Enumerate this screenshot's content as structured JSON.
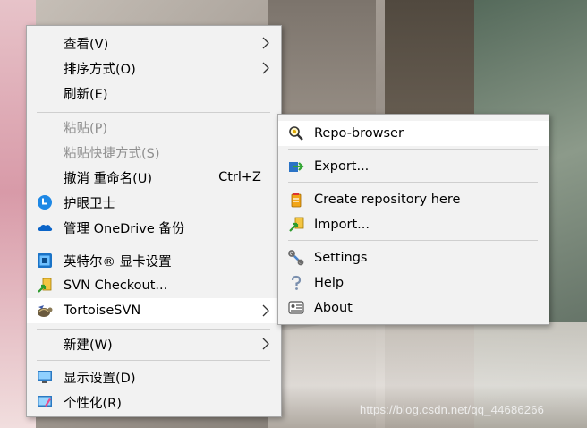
{
  "watermark": "https://blog.csdn.net/qq_44686266",
  "main_menu": {
    "view": "查看(V)",
    "sort": "排序方式(O)",
    "refresh": "刷新(E)",
    "paste": "粘贴(P)",
    "paste_shortcut": "粘贴快捷方式(S)",
    "undo_rename": "撤消 重命名(U)",
    "undo_shortcut": "Ctrl+Z",
    "eye_guard": "护眼卫士",
    "onedrive": "管理 OneDrive 备份",
    "intel_graphics": "英特尔® 显卡设置",
    "svn_checkout": "SVN Checkout...",
    "tortoise_svn": "TortoiseSVN",
    "new": "新建(W)",
    "display_settings": "显示设置(D)",
    "personalize": "个性化(R)"
  },
  "sub_menu": {
    "repo_browser": "Repo-browser",
    "export": "Export...",
    "create_repo": "Create repository here",
    "import": "Import...",
    "settings": "Settings",
    "help": "Help",
    "about": "About"
  },
  "icons": {
    "eye_guard": "blue-circle-clock-icon",
    "onedrive": "cloud-icon",
    "intel_graphics": "display-adapter-icon",
    "svn_checkout": "svn-checkout-icon",
    "tortoise_svn": "tortoise-icon",
    "display_settings": "monitor-icon",
    "personalize": "personalize-icon",
    "repo_browser": "magnifier-icon",
    "export": "export-icon",
    "create_repo": "repository-icon",
    "import": "import-icon",
    "settings": "wrench-icon",
    "help": "question-mark-icon",
    "about": "about-icon"
  }
}
